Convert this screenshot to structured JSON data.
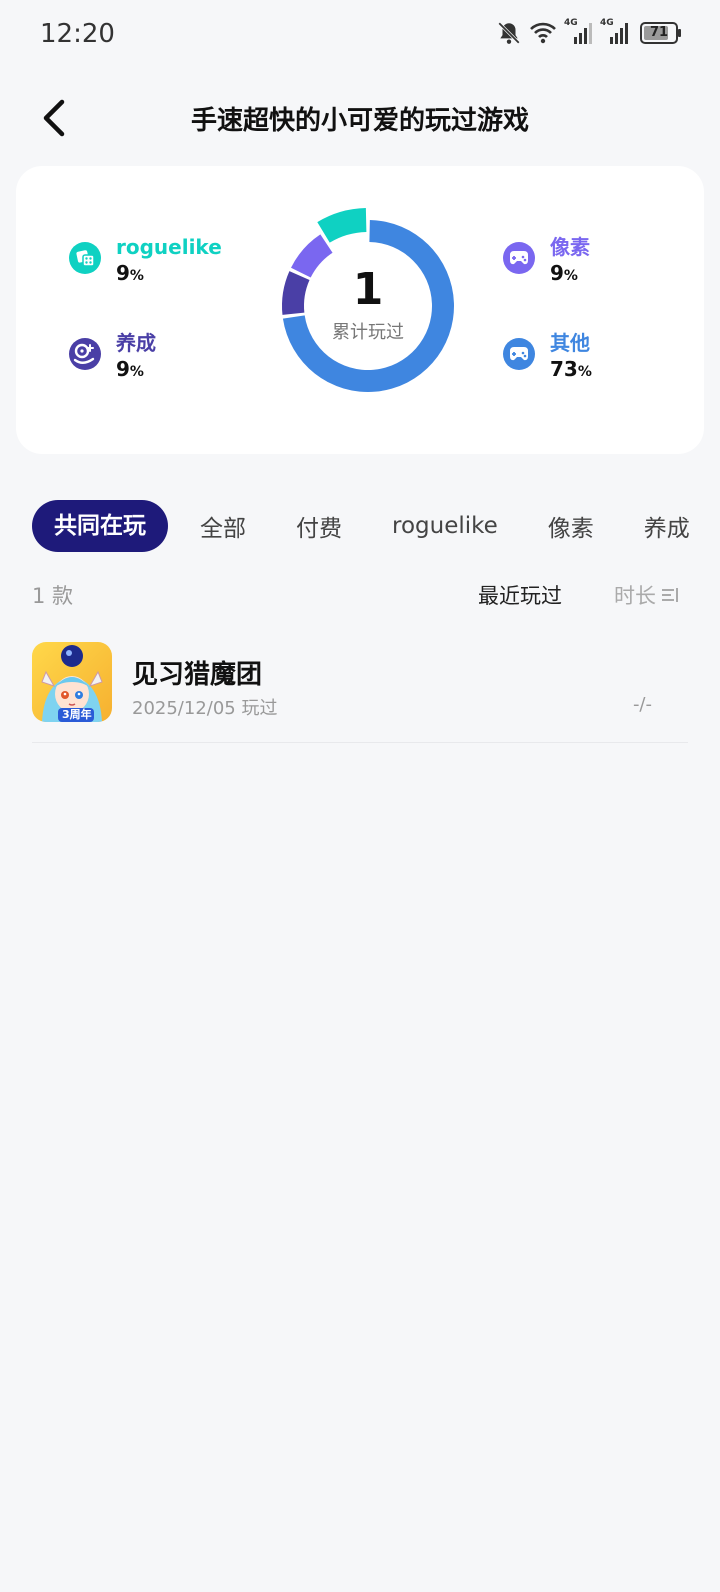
{
  "status": {
    "time": "12:20",
    "battery": "71",
    "net1": "4G",
    "net2": "4G"
  },
  "header": {
    "title": "手速超快的小可爱的玩过游戏"
  },
  "summary": {
    "total": "1",
    "total_label": "累计玩过",
    "categories": [
      {
        "name": "roguelike",
        "percent": "9",
        "unit": "%",
        "color": "#0fd1c2",
        "icon": "dice-icon"
      },
      {
        "name": "养成",
        "percent": "9",
        "unit": "%",
        "color": "#4a3fa6",
        "icon": "nurture-icon"
      },
      {
        "name": "像素",
        "percent": "9",
        "unit": "%",
        "color": "#7a67f0",
        "icon": "gamepad-icon"
      },
      {
        "name": "其他",
        "percent": "73",
        "unit": "%",
        "color": "#3f86e0",
        "icon": "gamepad-icon"
      }
    ]
  },
  "tabs": [
    "共同在玩",
    "全部",
    "付费",
    "roguelike",
    "像素",
    "养成"
  ],
  "list": {
    "count": "1 款",
    "sort_recent": "最近玩过",
    "sort_duration": "时长",
    "games": [
      {
        "name": "见习猎魔团",
        "date": "2025/12/05 玩过",
        "duration": "-/-",
        "badge": "3周年"
      }
    ]
  }
}
